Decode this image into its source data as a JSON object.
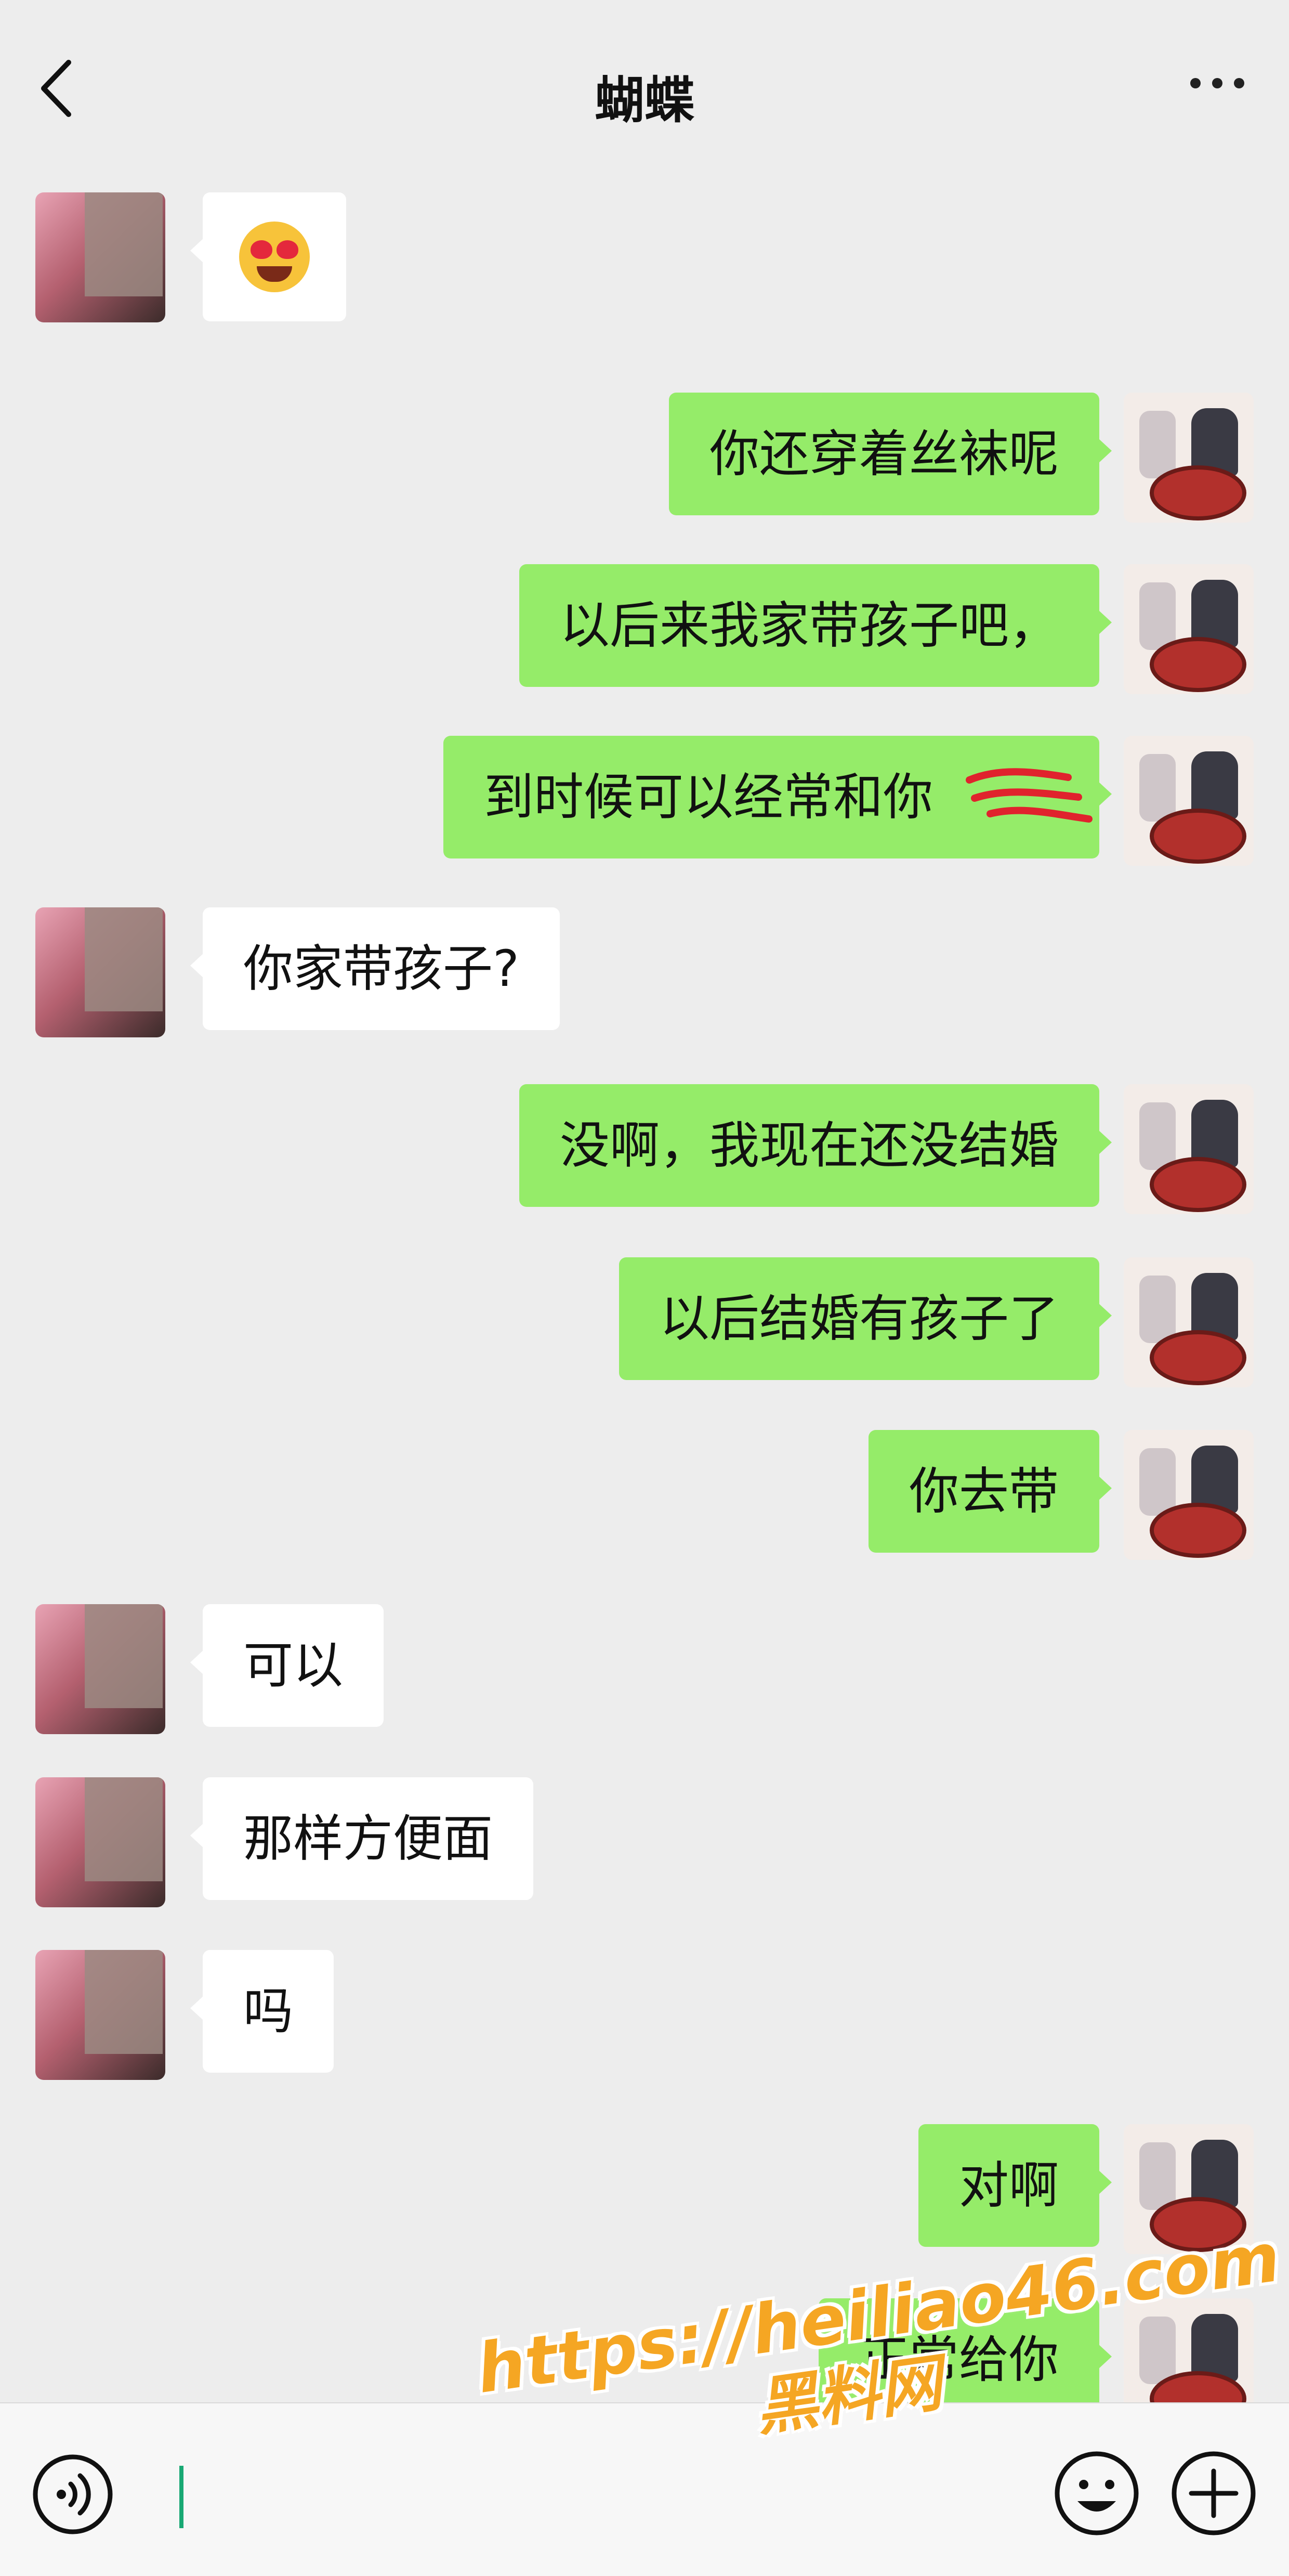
{
  "header": {
    "title": "蝴蝶",
    "back_icon": "chevron-left-icon",
    "more_icon": "more-horizontal-icon"
  },
  "messages": [
    {
      "side": "in",
      "type": "emoji",
      "emoji": "😍"
    },
    {
      "side": "out",
      "text": "你还穿着丝袜呢"
    },
    {
      "side": "out",
      "text": "以后来我家带孩子吧，"
    },
    {
      "side": "out",
      "text": "到时候可以经常和你"
    },
    {
      "side": "in",
      "text": "你家带孩子?"
    },
    {
      "side": "out",
      "text": "没啊，我现在还没结婚"
    },
    {
      "side": "out",
      "text": "以后结婚有孩子了"
    },
    {
      "side": "out",
      "text": "你去带"
    },
    {
      "side": "in",
      "text": "可以"
    },
    {
      "side": "in",
      "text": "那样方便面"
    },
    {
      "side": "in",
      "text": "吗"
    },
    {
      "side": "out",
      "text": "对啊"
    },
    {
      "side": "out",
      "text": "正常给你"
    }
  ],
  "input_bar": {
    "voice_icon": "voice-icon",
    "emoji_icon": "emoji-icon",
    "plus_icon": "plus-icon",
    "accent_color": "#19a974"
  },
  "watermark": {
    "url": "https://heiliao46.com",
    "name": "黑料网"
  },
  "colors": {
    "background": "#ededed",
    "outgoing_bubble": "#95ec69",
    "incoming_bubble": "#ffffff"
  }
}
